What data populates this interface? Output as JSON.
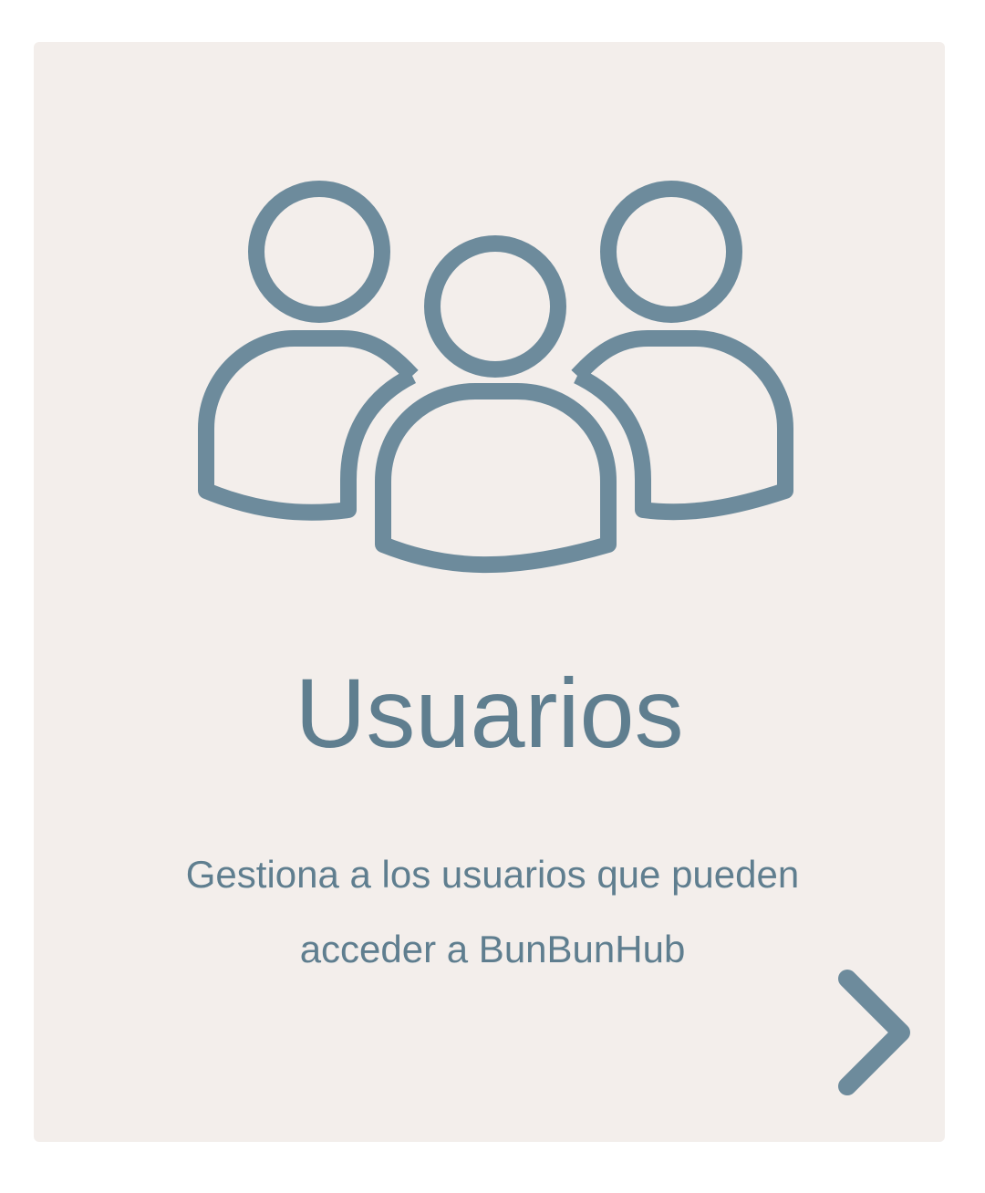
{
  "card": {
    "title": "Usuarios",
    "description": "Gestiona a los usuarios que pueden acceder a BunBunHub",
    "icon": "users-group-icon",
    "action_icon": "chevron-right-icon"
  },
  "colors": {
    "card_background": "#f3eeeb",
    "accent": "#6d8b9c",
    "text": "#5f7e8f",
    "page_background": "#ffffff"
  }
}
